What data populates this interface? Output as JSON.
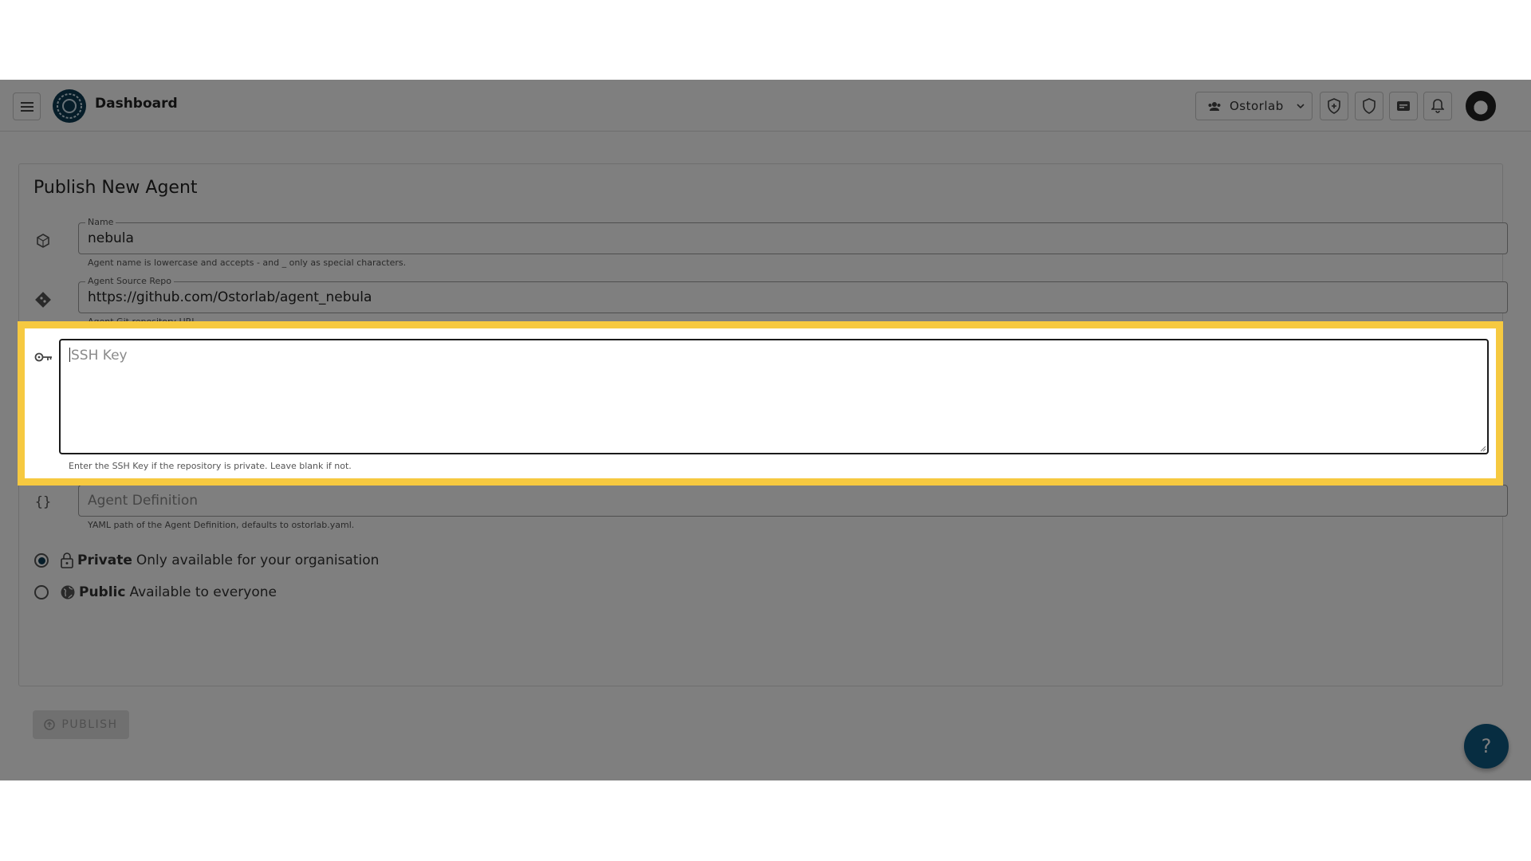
{
  "header": {
    "app_title": "Dashboard",
    "org_name": "Ostorlab"
  },
  "form": {
    "title": "Publish New Agent",
    "name": {
      "label": "Name",
      "value": "nebula",
      "helper": "Agent name is lowercase and accepts - and _ only as special characters."
    },
    "repo": {
      "label": "Agent Source Repo",
      "value": "https://github.com/Ostorlab/agent_nebula",
      "helper": "Agent Git repository URL"
    },
    "ssh": {
      "placeholder": "SSH Key",
      "helper": "Enter the SSH Key if the repository is private. Leave blank if not."
    },
    "definition": {
      "placeholder": "Agent Definition",
      "helper": "YAML path of the Agent Definition, defaults to ostorlab.yaml."
    },
    "visibility": {
      "private": {
        "title": "Private",
        "desc": "Only available for your organisation",
        "selected": true
      },
      "public": {
        "title": "Public",
        "desc": "Available to everyone",
        "selected": false
      }
    },
    "publish_label": "PUBLISH"
  },
  "help_label": "?",
  "colors": {
    "highlight": "#f6c940",
    "brand": "#0d3b52",
    "fab": "#0f5a82"
  }
}
